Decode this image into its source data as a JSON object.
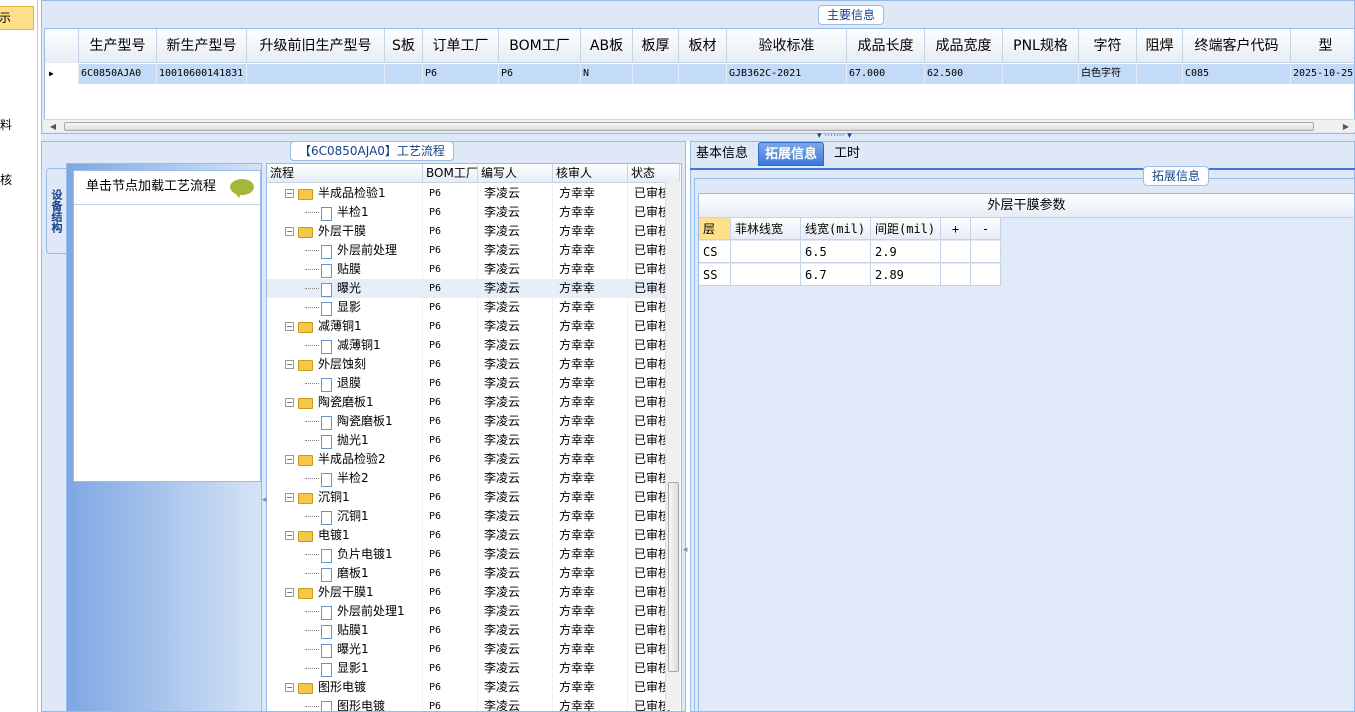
{
  "left_nav": {
    "items": [
      "示",
      "",
      "料",
      "核"
    ]
  },
  "main_info": {
    "group_title": "主要信息",
    "columns": [
      "",
      "生产型号",
      "新生产型号",
      "升级前旧生产型号",
      "S板",
      "订单工厂",
      "BOM工厂",
      "AB板",
      "板厚",
      "板材",
      "验收标准",
      "成品长度",
      "成品宽度",
      "PNL规格",
      "字符",
      "阻焊",
      "终端客户代码",
      "型"
    ],
    "rows": [
      [
        "▶",
        "6C0850AJA0",
        "10010600141831",
        "",
        "",
        "P6",
        "P6",
        "N",
        "",
        "",
        "GJB362C-2021",
        "67.000",
        "62.500",
        "",
        "白色字符",
        "",
        "C085",
        "2025-10-25"
      ]
    ]
  },
  "process_flow": {
    "group_title": "【6C0850AJA0】工艺流程",
    "side_tab": "设备结构",
    "device_header": "单击节点加载工艺流程",
    "columns": [
      "流程",
      "BOM工厂",
      "编写人",
      "核审人",
      "状态"
    ],
    "rows": [
      {
        "level": 0,
        "name": "半成品检验1",
        "bom": "P6",
        "writer": "李凌云",
        "reviewer": "方幸幸",
        "status": "已审核"
      },
      {
        "level": 1,
        "name": "半检1",
        "bom": "P6",
        "writer": "李凌云",
        "reviewer": "方幸幸",
        "status": "已审核"
      },
      {
        "level": 0,
        "name": "外层干膜",
        "bom": "P6",
        "writer": "李凌云",
        "reviewer": "方幸幸",
        "status": "已审核"
      },
      {
        "level": 1,
        "name": "外层前处理",
        "bom": "P6",
        "writer": "李凌云",
        "reviewer": "方幸幸",
        "status": "已审核"
      },
      {
        "level": 1,
        "name": "贴膜",
        "bom": "P6",
        "writer": "李凌云",
        "reviewer": "方幸幸",
        "status": "已审核"
      },
      {
        "level": 1,
        "name": "曝光",
        "bom": "P6",
        "writer": "李凌云",
        "reviewer": "方幸幸",
        "status": "已审核",
        "selected": true
      },
      {
        "level": 1,
        "name": "显影",
        "bom": "P6",
        "writer": "李凌云",
        "reviewer": "方幸幸",
        "status": "已审核"
      },
      {
        "level": 0,
        "name": "减薄铜1",
        "bom": "P6",
        "writer": "李凌云",
        "reviewer": "方幸幸",
        "status": "已审核"
      },
      {
        "level": 1,
        "name": "减薄铜1",
        "bom": "P6",
        "writer": "李凌云",
        "reviewer": "方幸幸",
        "status": "已审核"
      },
      {
        "level": 0,
        "name": "外层蚀刻",
        "bom": "P6",
        "writer": "李凌云",
        "reviewer": "方幸幸",
        "status": "已审核"
      },
      {
        "level": 1,
        "name": "退膜",
        "bom": "P6",
        "writer": "李凌云",
        "reviewer": "方幸幸",
        "status": "已审核"
      },
      {
        "level": 0,
        "name": "陶瓷磨板1",
        "bom": "P6",
        "writer": "李凌云",
        "reviewer": "方幸幸",
        "status": "已审核"
      },
      {
        "level": 1,
        "name": "陶瓷磨板1",
        "bom": "P6",
        "writer": "李凌云",
        "reviewer": "方幸幸",
        "status": "已审核"
      },
      {
        "level": 1,
        "name": "抛光1",
        "bom": "P6",
        "writer": "李凌云",
        "reviewer": "方幸幸",
        "status": "已审核"
      },
      {
        "level": 0,
        "name": "半成品检验2",
        "bom": "P6",
        "writer": "李凌云",
        "reviewer": "方幸幸",
        "status": "已审核"
      },
      {
        "level": 1,
        "name": "半检2",
        "bom": "P6",
        "writer": "李凌云",
        "reviewer": "方幸幸",
        "status": "已审核"
      },
      {
        "level": 0,
        "name": "沉铜1",
        "bom": "P6",
        "writer": "李凌云",
        "reviewer": "方幸幸",
        "status": "已审核"
      },
      {
        "level": 1,
        "name": "沉铜1",
        "bom": "P6",
        "writer": "李凌云",
        "reviewer": "方幸幸",
        "status": "已审核"
      },
      {
        "level": 0,
        "name": "电镀1",
        "bom": "P6",
        "writer": "李凌云",
        "reviewer": "方幸幸",
        "status": "已审核"
      },
      {
        "level": 1,
        "name": "负片电镀1",
        "bom": "P6",
        "writer": "李凌云",
        "reviewer": "方幸幸",
        "status": "已审核"
      },
      {
        "level": 1,
        "name": "磨板1",
        "bom": "P6",
        "writer": "李凌云",
        "reviewer": "方幸幸",
        "status": "已审核"
      },
      {
        "level": 0,
        "name": "外层干膜1",
        "bom": "P6",
        "writer": "李凌云",
        "reviewer": "方幸幸",
        "status": "已审核"
      },
      {
        "level": 1,
        "name": "外层前处理1",
        "bom": "P6",
        "writer": "李凌云",
        "reviewer": "方幸幸",
        "status": "已审核"
      },
      {
        "level": 1,
        "name": "贴膜1",
        "bom": "P6",
        "writer": "李凌云",
        "reviewer": "方幸幸",
        "status": "已审核"
      },
      {
        "level": 1,
        "name": "曝光1",
        "bom": "P6",
        "writer": "李凌云",
        "reviewer": "方幸幸",
        "status": "已审核"
      },
      {
        "level": 1,
        "name": "显影1",
        "bom": "P6",
        "writer": "李凌云",
        "reviewer": "方幸幸",
        "status": "已审核"
      },
      {
        "level": 0,
        "name": "图形电镀",
        "bom": "P6",
        "writer": "李凌云",
        "reviewer": "方幸幸",
        "status": "已审核"
      },
      {
        "level": 1,
        "name": "图形电镀",
        "bom": "P6",
        "writer": "李凌云",
        "reviewer": "方幸幸",
        "status": "已审核"
      }
    ]
  },
  "right_panel": {
    "tabs": [
      {
        "label": "基本信息",
        "active": false
      },
      {
        "label": "拓展信息",
        "active": true
      },
      {
        "label": "工时",
        "active": false
      }
    ],
    "group_title": "拓展信息",
    "grid_title": "外层干膜参数",
    "columns": [
      "层",
      "菲林线宽",
      "线宽(mil)",
      "间距(mil)",
      "+",
      "-"
    ],
    "rows": [
      [
        "CS",
        "",
        "6.5",
        "2.9",
        "",
        ""
      ],
      [
        "SS",
        "",
        "6.7",
        "2.89",
        "",
        ""
      ]
    ]
  },
  "colors": {
    "panel_bg": "#dfe8f6",
    "border": "#99bbe8",
    "selected_row": "#c4dbf7",
    "active_tab": "#3c78d8"
  }
}
